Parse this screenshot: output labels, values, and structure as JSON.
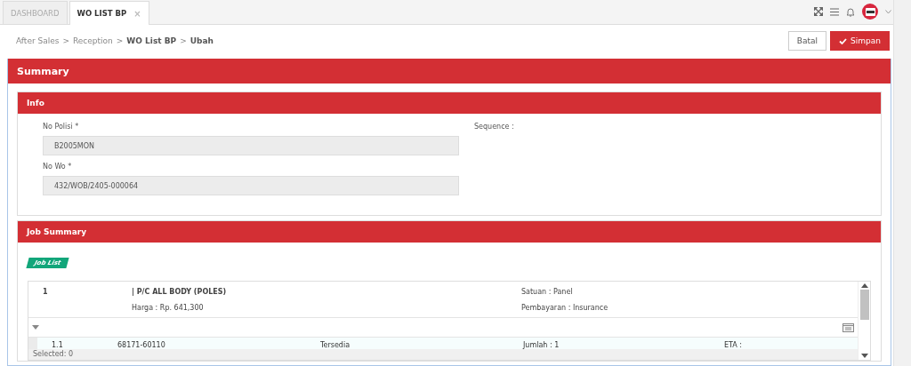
{
  "tabs": [
    {
      "label": "DASHBOARD",
      "selected": false,
      "closable": false
    },
    {
      "label": "WO LIST BP",
      "selected": true,
      "closable": true
    }
  ],
  "close_glyph": "×",
  "breadcrumb": [
    {
      "label": "After Sales",
      "current": false
    },
    {
      "label": "Reception",
      "current": false
    },
    {
      "label": "WO List BP",
      "current": true
    },
    {
      "label": "Ubah",
      "current": true
    }
  ],
  "breadcrumb_separator": ">",
  "actions": {
    "cancel": "Batal",
    "save": "Simpan"
  },
  "summary": {
    "title": "Summary",
    "info": {
      "title": "Info",
      "fields": [
        {
          "label": "No Polisi *",
          "value": "B2005MON"
        },
        {
          "label": "No Wo *",
          "value": "432/WOB/2405-000064"
        }
      ],
      "sequence_label": "Sequence :"
    },
    "job_summary": {
      "title": "Job Summary",
      "badge": "Job List",
      "job": {
        "number": "1",
        "name": "| P/C ALL BODY (POLES)",
        "unit": "Satuan : Panel",
        "price": "Harga : Rp. 641,300",
        "payment": "Pembayaran : Insurance"
      },
      "parts": [
        {
          "number": "1.1",
          "code": "68171-60110",
          "status": "Tersedia",
          "qty": "Jumlah : 1",
          "eta": "ETA :"
        }
      ],
      "footer": "Selected: 0"
    }
  }
}
